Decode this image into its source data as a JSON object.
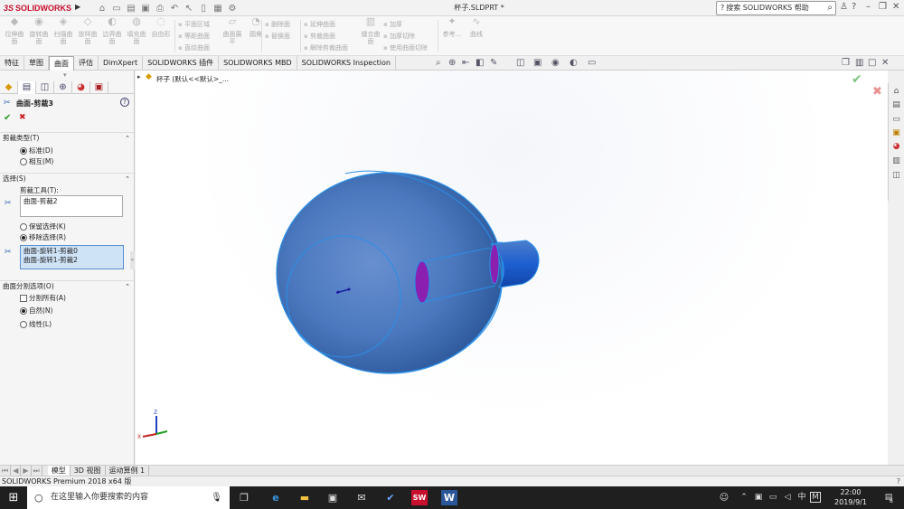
{
  "app": {
    "brand_ds": "3S",
    "brand": "SOLIDWORKS",
    "doc_title": "杯子.SLDPRT *",
    "search_placeholder": "搜索 SOLIDWORKS 帮助",
    "search_icon": "magnifier-icon",
    "help_icon": "question-circle-icon"
  },
  "ribbon": {
    "extrude": "拉伸曲面",
    "revolve": "旋转曲面",
    "sweep": "扫描曲面",
    "loft": "放样曲面",
    "boundary": "边界曲面",
    "fill": "填充曲面",
    "freeform": "自由形",
    "planar": "平面区域",
    "offset": "等距曲面",
    "ruled": "直纹曲面",
    "flatten": "曲面展平",
    "fillet": "圆角",
    "delete_face": "删除面",
    "replace_face": "替换面",
    "extend": "延伸曲面",
    "trim": "剪裁曲面",
    "untrim": "解除剪裁曲面",
    "knit": "缝合曲面",
    "thicken": "加厚",
    "thicken_cut": "加厚切除",
    "cut_with_surface": "使用曲面切除",
    "reference": "参考...",
    "curves": "曲线"
  },
  "tabs": [
    "特征",
    "草图",
    "曲面",
    "评估",
    "DimXpert",
    "SOLIDWORKS 插件",
    "SOLIDWORKS MBD",
    "SOLIDWORKS Inspection"
  ],
  "active_tab": "曲面",
  "tree": {
    "part_label": "杯子 (默认<<默认>_..."
  },
  "property_manager": {
    "title": "曲面-剪裁3",
    "ok": "✔",
    "cancel": "✖",
    "help": "?",
    "trim_type": {
      "header": "剪裁类型(T)",
      "options": [
        "标准(D)",
        "相互(M)"
      ],
      "selected": "标准(D)"
    },
    "selections": {
      "header": "选择(S)",
      "trim_tool_label": "剪裁工具(T):",
      "trim_tool_value": "曲面-剪裁2",
      "keep_option": "保留选择(K)",
      "remove_option": "移除选择(R)",
      "selected": "移除选择(R)",
      "faces": [
        "曲面-旋转1-剪裁0",
        "曲面-旋转1-剪裁2"
      ]
    },
    "split": {
      "header": "曲面分割选项(O)",
      "split_all": "分割所有(A)",
      "natural": "自然(N)",
      "linear": "线性(L)",
      "selected": "自然(N)"
    }
  },
  "bottom_tabs": [
    "模型",
    "3D 视图",
    "运动算例 1"
  ],
  "status": "SOLIDWORKS Premium 2018 x64 版",
  "taskbar": {
    "search_placeholder": "在这里输入你要搜索的内容",
    "ime": "中",
    "ime2": "M",
    "time": "22:00",
    "date": "2019/9/1",
    "notif_count": "6"
  },
  "colors": {
    "model_fill": "#4a79be",
    "model_edge": "#2b8fe8",
    "cut_face": "#8a1fb0",
    "accent": "#c8102e"
  }
}
